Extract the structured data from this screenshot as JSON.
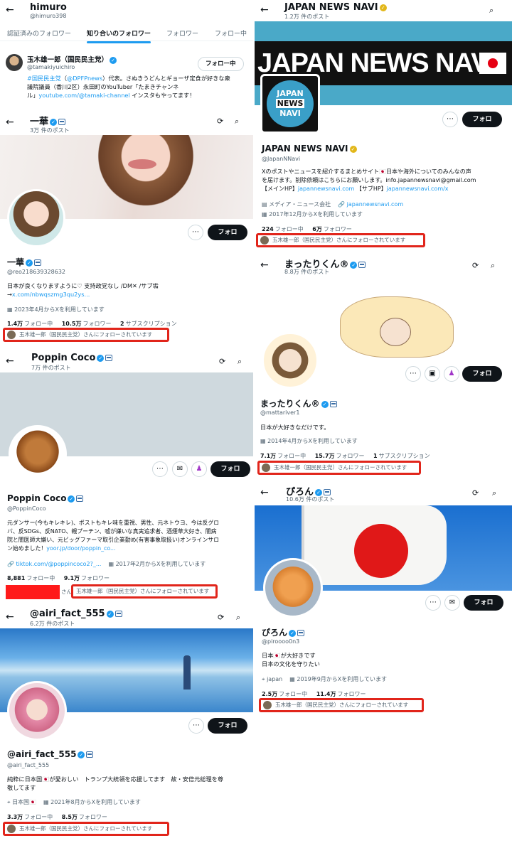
{
  "p1": {
    "header_name": "himuro",
    "header_handle": "@himuro398",
    "tabs": [
      "認証済みのフォロワー",
      "知り合いのフォロワー",
      "フォロワー",
      "フォロー中"
    ],
    "user": {
      "name": "玉木雄一郎（国民民主党）",
      "handle": "@tamakiyuichiro",
      "following_label": "フォロー中",
      "bio_l1_a": "#国民民主党",
      "bio_l1_b": "（",
      "bio_l1_c": "@DPFPnews",
      "bio_l1_d": "）代表。さぬきうどんとギョーザ定食が好きな衆",
      "bio_l2": "議院議員（香川2区）永田町のYouTuber「たまきチャンネ",
      "bio_l3_a": "ル」",
      "bio_l3_b": "youtube.com/@tamaki-channel",
      "bio_l3_c": " インスタもやってます！"
    }
  },
  "p2": {
    "title": "一華",
    "posts": "3万 件のポスト",
    "name": "一華",
    "handle": "@reo218639328632",
    "bio_l1": "日本が良くなりますように♡ 支持政党なし /DM✕ /サブ垢",
    "bio_l2_a": "→",
    "bio_l2_b": "x.com/nbwqszmg3qu2ys...",
    "joined": "2023年4月からXを利用しています",
    "following_n": "1.4万",
    "following_l": "フォロー中",
    "followers_n": "10.5万",
    "followers_l": "フォロワー",
    "subs_n": "2",
    "subs_l": "サブスクリプション",
    "followed_by": "玉木雄一郎（国民民主党）さんにフォローされています",
    "follow_label": "フォロー"
  },
  "p3": {
    "title": "Poppin Coco",
    "posts": "7万 件のポスト",
    "name": "Poppin Coco",
    "handle": "@PoppinCoco",
    "bio_l1": "元ダンサー(今もキレキレ)、ポストもキレ味を重視、男性、元ネトウヨ、今は反グロ",
    "bio_l2": "バ、反SDGs、反NATO、親プーチン、嘘が嫌いな真実追求者、酒煙草大好き、闇病",
    "bio_l3": "院と闇医師大嫌い、元ビッグファーマ取引企業勤め(有害事象取扱い)オンラインサロ",
    "bio_l4_a": "ン始めました！",
    "bio_l4_b": "yoor.jp/door/poppin_co...",
    "website": "tiktok.com/@poppincoco2?_...",
    "joined": "2017年2月からXを利用しています",
    "following_n": "8,881",
    "following_l": "フォロー中",
    "followers_n": "9.1万",
    "followers_l": "フォロワー",
    "followed_prefix": "さん",
    "followed_by": "玉木雄一郎（国民民主党）さんにフォローされています",
    "follow_label": "フォロー"
  },
  "p4": {
    "title": "@airi_fact_555",
    "posts": "6.2万 件のポスト",
    "name": "@airi_fact_555",
    "handle": "@airi_fact_555",
    "bio_l1": "純粋に日本国🇯🇵が愛おしい　トランプ大統領を応援してます　故・安倍元総理を尊",
    "bio_l2": "敬してます",
    "location": "日本国🇯🇵",
    "joined": "2021年8月からXを利用しています",
    "following_n": "3.3万",
    "following_l": "フォロー中",
    "followers_n": "8.5万",
    "followers_l": "フォロワー",
    "followed_by": "玉木雄一郎（国民民主党）さんにフォローされています",
    "follow_label": "フォロー"
  },
  "p5": {
    "title": "JAPAN NEWS NAVI",
    "posts": "1.2万 件のポスト",
    "banner_text": "JAPAN NEWS NAVI",
    "logo_l1": "JAPAN",
    "logo_l2": "NEWS",
    "logo_l3": "NAVI",
    "name": "JAPAN NEWS NAVI",
    "handle": "@JapanNNavi",
    "bio_l1": "Xのポストやニュースを紹介するまとめサイト🇯🇵日本や海外についてのみんなの声",
    "bio_l2": "を届けます。削除依頼はこちらにお願いします。info.japannewsnavi@gmail.com",
    "bio_l3_a": "【メインHP】",
    "bio_l3_b": "japannewsnavi.com",
    "bio_l3_c": " 【サブHP】",
    "bio_l3_d": "japannewsnavi.com/x",
    "category": "メディア・ニュース会社",
    "website": "japannewsnavi.com",
    "joined": "2017年12月からXを利用しています",
    "following_n": "224",
    "following_l": "フォロー中",
    "followers_n": "6万",
    "followers_l": "フォロワー",
    "followed_by": "玉木雄一郎（国民民主党）さんにフォローされています",
    "follow_label": "フォロー"
  },
  "p6": {
    "title": "まったりくん®",
    "posts": "8.8万 件のポスト",
    "name": "まったりくん®",
    "handle": "@mattariver1",
    "bio_l1": "日本が大好きなだけです。",
    "joined": "2014年4月からXを利用しています",
    "following_n": "7.1万",
    "following_l": "フォロー中",
    "followers_n": "15.7万",
    "followers_l": "フォロワー",
    "subs_n": "1",
    "subs_l": "サブスクリプション",
    "followed_by": "玉木雄一郎（国民民主党）さんにフォローされています",
    "follow_label": "フォロー"
  },
  "p7": {
    "title": "ぴろん",
    "posts": "10.6万 件のポスト",
    "name": "ぴろん",
    "handle": "@piroooo0n3",
    "bio_l1": "日本🇯🇵が大好きです",
    "bio_l2": "日本の文化を守りたい",
    "location": "japan",
    "joined": "2019年9月からXを利用しています",
    "following_n": "2.5万",
    "following_l": "フォロー中",
    "followers_n": "11.4万",
    "followers_l": "フォロワー",
    "followed_by": "玉木雄一郎（国民民主党）さんにフォローされています",
    "follow_label": "フォロー"
  },
  "colors": {
    "accent": "#1d9bf0",
    "highlight": "#e1251b",
    "follow_bg": "#0f1419"
  }
}
